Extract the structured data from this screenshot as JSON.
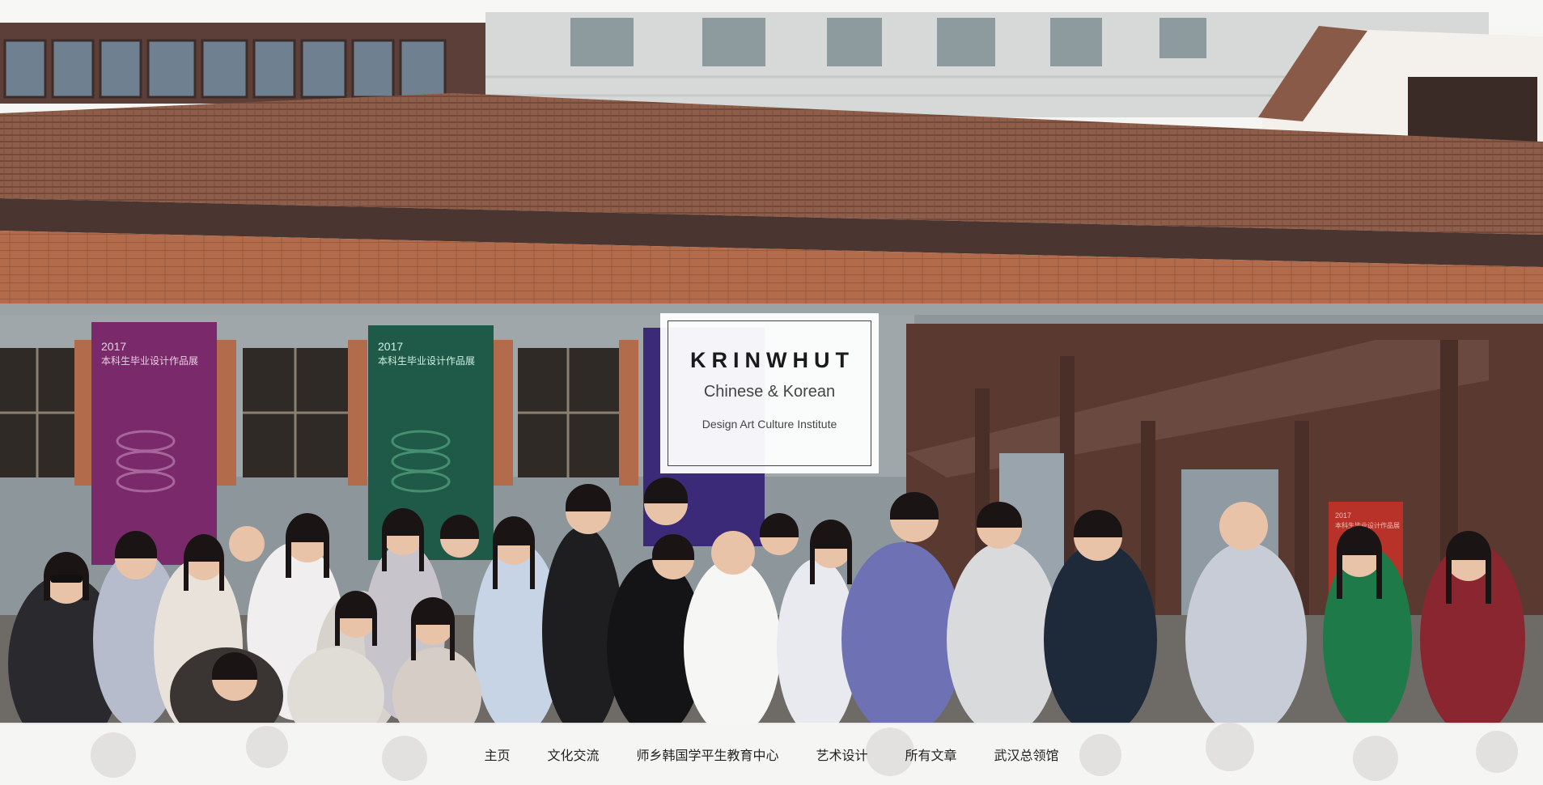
{
  "hero": {
    "brand_title": "KRINWHUT",
    "subtitle": "Chinese & Korean",
    "tagline": "Design Art Culture Institute",
    "banners": [
      {
        "year": "2017",
        "text": "本科生毕业设计作品展",
        "color": "#7a2a6a"
      },
      {
        "year": "2017",
        "text": "本科生毕业设计作品展",
        "color": "#1f5a48"
      },
      {
        "year": "2017",
        "text": "本科生毕业设计作品展",
        "color": "#b8322a"
      }
    ]
  },
  "nav": {
    "items": [
      {
        "label": "主页"
      },
      {
        "label": "文化交流"
      },
      {
        "label": "师乡韩国学平生教育中心"
      },
      {
        "label": "艺术设计"
      },
      {
        "label": "所有文章"
      },
      {
        "label": "武汉总领馆"
      }
    ]
  },
  "colors": {
    "roof": "#8a5a48",
    "brick": "#b06a4a",
    "window": "#3a3530",
    "nav_bg": "#f5f5f3",
    "title_box": "#ffffff"
  }
}
